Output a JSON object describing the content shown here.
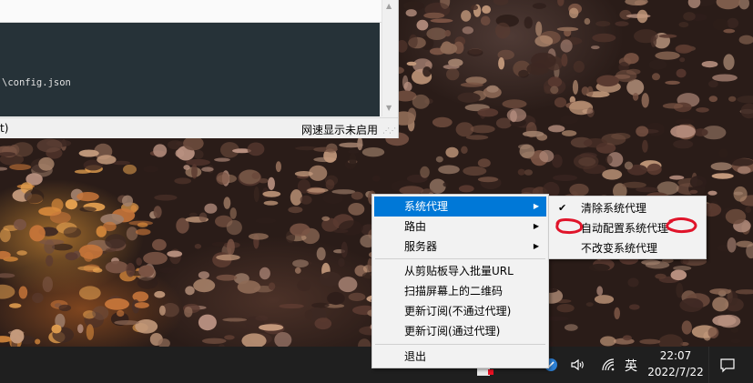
{
  "app_window": {
    "log_line": "\\config.json",
    "status_left": "t)",
    "status_right": "网速显示未启用"
  },
  "taskbar": {
    "ime": "英",
    "time": "22:07",
    "date": "2022/7/22",
    "icons": [
      "v2rayn-tray-icon",
      "speaker-icon",
      "wifi-icon",
      "notification-icon"
    ]
  },
  "menu": {
    "items": [
      {
        "label": "系统代理",
        "has_submenu": true,
        "active": true
      },
      {
        "label": "路由",
        "has_submenu": true
      },
      {
        "label": "服务器",
        "has_submenu": true
      },
      {
        "label": "从剪贴板导入批量URL"
      },
      {
        "label": "扫描屏幕上的二维码"
      },
      {
        "label": "更新订阅(不通过代理)"
      },
      {
        "label": "更新订阅(通过代理)"
      },
      {
        "label": "退出"
      }
    ],
    "submenu": [
      {
        "label": "清除系统代理",
        "checked": true
      },
      {
        "label": "自动配置系统代理"
      },
      {
        "label": "不改变系统代理"
      }
    ]
  },
  "colors": {
    "menu_highlight": "#0078d7",
    "annotation": "#e0142a",
    "log_background": "#263238"
  }
}
